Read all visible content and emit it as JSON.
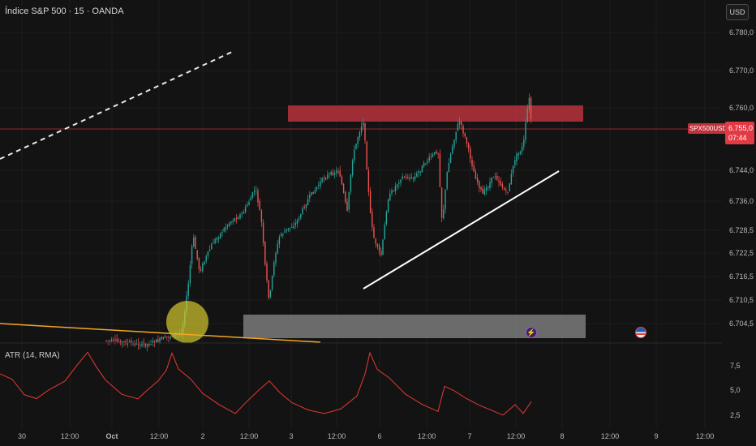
{
  "header": {
    "title": "Índice S&P 500 · 15 · OANDA",
    "currency_button": "USD"
  },
  "price_axis": {
    "labels": [
      "6.780,0",
      "6.770,0",
      "6.760,0",
      "6.744,0",
      "6.736,0",
      "6.728,5",
      "6.722,5",
      "6.716,5",
      "6.710,5",
      "6.704,5"
    ]
  },
  "current_price": {
    "symbol": "SPX500USD",
    "value": "6.755,0",
    "countdown": "07:44"
  },
  "indicator": {
    "title": "ATR (14, RMA)",
    "axis_labels": [
      "7,5",
      "5,0",
      "2,5"
    ]
  },
  "time_axis": {
    "labels": [
      "30",
      "12:00",
      "Oct",
      "12:00",
      "2",
      "12:00",
      "3",
      "12:00",
      "6",
      "12:00",
      "7",
      "12:00",
      "8",
      "12:00",
      "9",
      "12:00"
    ]
  },
  "colors": {
    "background": "#131313",
    "bull": "#26a69a",
    "bear": "#ef5350",
    "resistance_zone": "#b8333d",
    "support_zone": "#9e9e9e",
    "atr_line": "#e53935",
    "orange_line": "#f5a623",
    "highlight_circle": "#e6d23a"
  },
  "icons": {
    "event_bolt": "lightning-icon",
    "event_flag": "us-flag-icon"
  }
}
